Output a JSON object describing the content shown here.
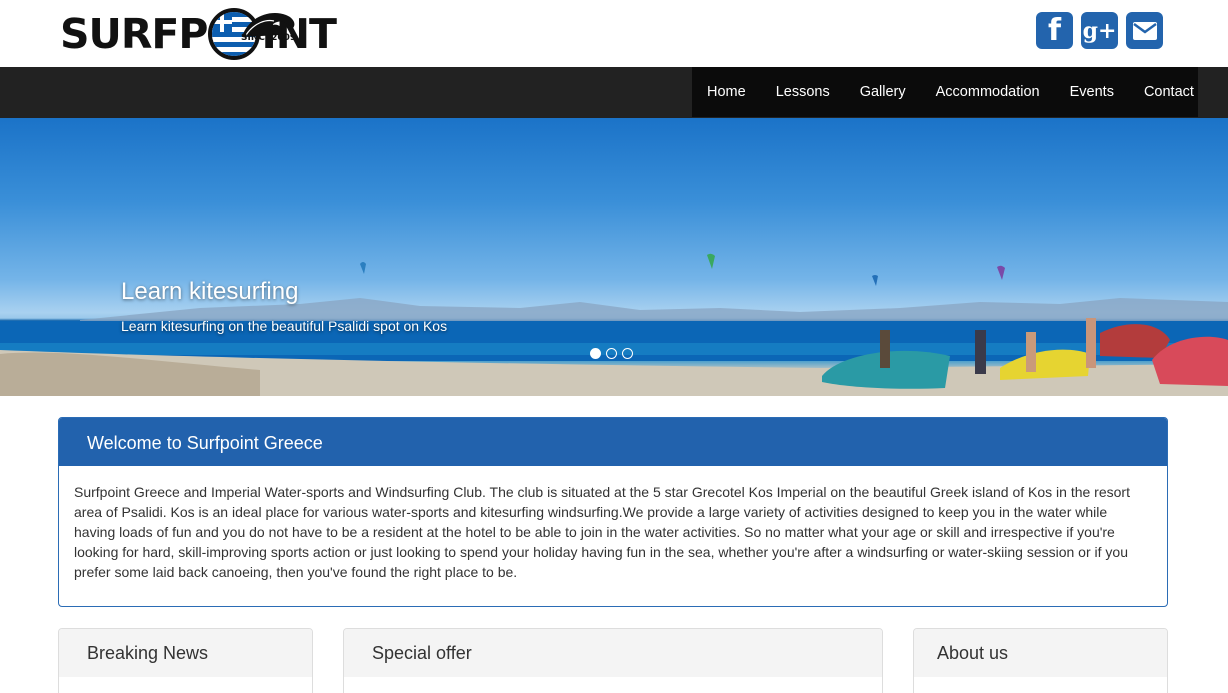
{
  "brand": {
    "logo_part1": "SURFP",
    "logo_part2": "INT",
    "logo_since": "SINCE2009",
    "flag_colors": {
      "blue": "#0d5eaf",
      "white": "#ffffff"
    }
  },
  "social": {
    "facebook_glyph": "f",
    "googleplus_glyph": "g+",
    "icons": [
      "facebook-icon",
      "google-plus-icon",
      "envelope-icon"
    ],
    "color": "#2364ad"
  },
  "nav": {
    "items": [
      {
        "label": "Home"
      },
      {
        "label": "Lessons"
      },
      {
        "label": "Gallery"
      },
      {
        "label": "Accommodation"
      },
      {
        "label": "Events"
      },
      {
        "label": "Contact"
      }
    ]
  },
  "hero": {
    "title": "Learn kitesurfing",
    "subtitle": "Learn kitesurfing on the beautiful Psalidi spot on Kos",
    "slides": 3,
    "active_slide": 1
  },
  "welcome": {
    "title": "Welcome to Surfpoint Greece",
    "body": "Surfpoint Greece and Imperial Water-sports and Windsurfing Club. The club is situated at the 5 star Grecotel Kos Imperial on the beautiful Greek island of Kos in the resort area of Psalidi. Kos is an ideal place for various water-sports and kitesurfing windsurfing.We provide a large variety of activities designed to keep you in the water while having loads of fun and you do not have to be a resident at the hotel to be able to join in the water activities. So no matter what your age or skill and irrespective if you're looking for hard, skill-improving sports action or just looking to spend your holiday having fun in the sea, whether you're after a windsurfing or water-skiing session or if you prefer some laid back canoeing, then you've found the right place to be."
  },
  "panels": {
    "breaking_news": {
      "title": "Breaking News"
    },
    "special_offer": {
      "title": "Special offer"
    },
    "about_us": {
      "title": "About us"
    }
  }
}
